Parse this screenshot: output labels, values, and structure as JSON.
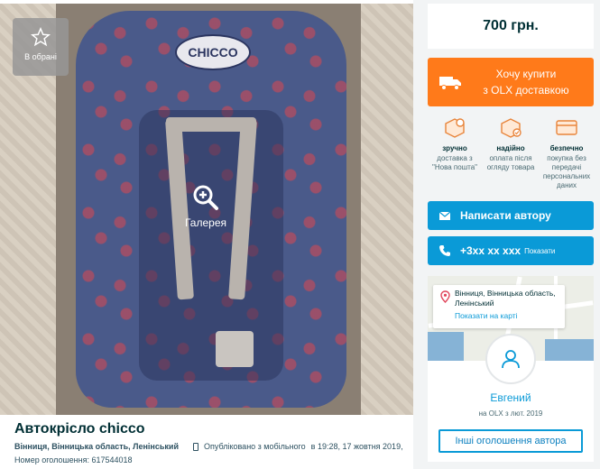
{
  "favorite": {
    "label": "В обрані",
    "icon": "star-outline-icon"
  },
  "gallery": {
    "label": "Галерея",
    "icon": "zoom-in-icon"
  },
  "photo": {
    "brand_text": "CHICCO"
  },
  "listing": {
    "title": "Автокрісло chicco",
    "location": "Вінниця, Вінницька область, Ленінський",
    "published_via": "Опубліковано з мобільного",
    "published_at": "в 19:28, 17 жовтня 2019,",
    "ad_number": "Номер оголошення: 617544018"
  },
  "price": "700 грн.",
  "olx_delivery": {
    "line1": "Хочу купити",
    "line2": "з OLX доставкою",
    "icon": "truck-icon"
  },
  "benefits": [
    {
      "title": "зручно",
      "text": "доставка з \"Нова пошта\"",
      "icon": "box-pin-icon"
    },
    {
      "title": "надійно",
      "text": "оплата після огляду товара",
      "icon": "box-check-icon"
    },
    {
      "title": "безпечно",
      "text": "покупка без передачі персональних даних",
      "icon": "card-icon"
    }
  ],
  "message_button": {
    "label": "Написати автору",
    "icon": "envelope-icon"
  },
  "phone_button": {
    "number": "+3xx xx xxx",
    "show": "Показати",
    "icon": "phone-icon"
  },
  "map": {
    "address": "Вінниця, Вінницька область, Ленінський",
    "show_map": "Показати на карті",
    "icon": "pin-icon"
  },
  "seller": {
    "name": "Евгений",
    "since": "на OLX з лют. 2019",
    "other_ads": "Інші оголошення автора",
    "icon": "user-avatar-icon"
  },
  "colors": {
    "orange": "#ff7a1a",
    "blue": "#0a9ad7",
    "text": "#002f34"
  }
}
